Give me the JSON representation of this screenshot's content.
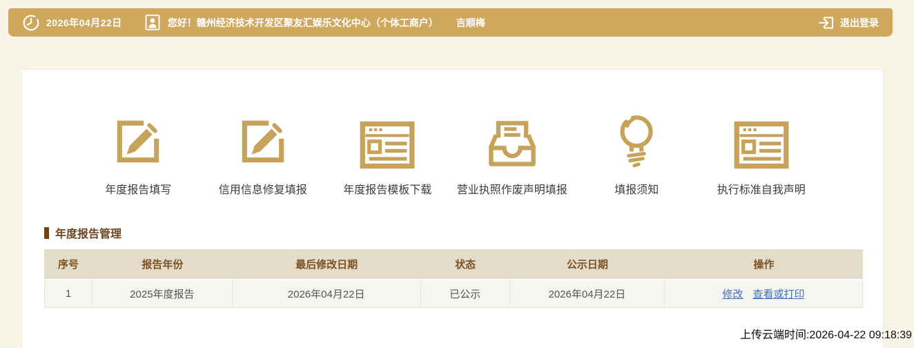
{
  "topbar": {
    "date": "2026年04月22日",
    "greeting": "您好！赣州经济技术开发区聚友汇娱乐文化中心（个体工商户）",
    "username": "吉顺梅",
    "logout_label": "退出登录"
  },
  "quick_actions": [
    {
      "icon": "edit-icon",
      "label": "年度报告填写"
    },
    {
      "icon": "edit-icon",
      "label": "信用信息修复填报"
    },
    {
      "icon": "webpage-icon",
      "label": "年度报告模板下载"
    },
    {
      "icon": "inbox-icon",
      "label": "营业执照作废声明填报"
    },
    {
      "icon": "lightbulb-icon",
      "label": "填报须知"
    },
    {
      "icon": "webpage-icon",
      "label": "执行标准自我声明"
    }
  ],
  "section": {
    "title": "年度报告管理"
  },
  "table": {
    "headers": [
      "序号",
      "报告年份",
      "最后修改日期",
      "状态",
      "公示日期",
      "操作"
    ],
    "rows": [
      {
        "seq": "1",
        "year": "2025年度报告",
        "modified": "2026年04月22日",
        "status": "已公示",
        "publish": "2026年04月22日",
        "actions": [
          "修改",
          "查看或打印"
        ]
      }
    ]
  },
  "footer": {
    "upload_time": "上传云端时间:2026-04-22 09:18:39"
  },
  "colors": {
    "topbar_gold": "#cfa85e",
    "page_beige": "#f9f4e8",
    "icon_gold": "#c6a25b",
    "title_brown": "#6b4523",
    "table_header_bg": "#e4dbc9",
    "table_header_text": "#7a5224",
    "row_bg": "#f6f5f1",
    "link_blue": "#3a6cc5"
  }
}
